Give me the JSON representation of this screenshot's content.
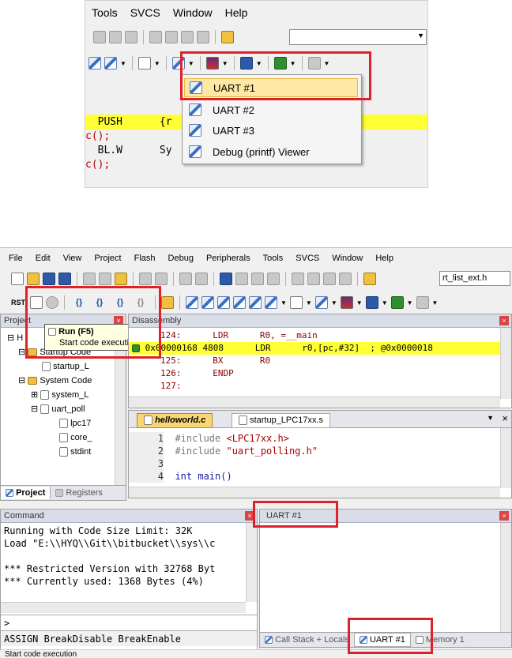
{
  "top": {
    "menu": [
      "Tools",
      "SVCS",
      "Window",
      "Help"
    ],
    "dropdown_items": [
      "UART #1",
      "UART #2",
      "UART #3",
      "Debug (printf) Viewer"
    ],
    "code": [
      {
        "text": "  PUSH      {r",
        "highlight": true
      },
      {
        "text": "c();",
        "highlight": false
      },
      {
        "text": "  BL.W      Sy",
        "highlight": false
      },
      {
        "text": "c();",
        "highlight": false
      }
    ]
  },
  "bottom": {
    "menu": [
      "File",
      "Edit",
      "View",
      "Project",
      "Flash",
      "Debug",
      "Peripherals",
      "Tools",
      "SVCS",
      "Window",
      "Help"
    ],
    "search_value": "rt_list_ext.h",
    "rst_label": "RST",
    "debug_buttons": [
      "{}",
      "{}",
      "{}",
      "{}"
    ],
    "project_panel": {
      "title": "Project",
      "tree": [
        {
          "label": "H",
          "depth": 0
        },
        {
          "label": "Startup Code",
          "depth": 1
        },
        {
          "label": "startup_L",
          "depth": 2
        },
        {
          "label": "System Code",
          "depth": 1
        },
        {
          "label": "system_L",
          "depth": 2
        },
        {
          "label": "uart_poll",
          "depth": 2
        },
        {
          "label": "lpc17",
          "depth": 3
        },
        {
          "label": "core_",
          "depth": 3
        },
        {
          "label": "stdint",
          "depth": 3
        }
      ],
      "tab_project": "Project",
      "tab_registers": "Registers"
    },
    "tooltip": {
      "title": "Run (F5)",
      "desc": "Start code execution"
    },
    "disassembly": {
      "title": "Disassembly",
      "lines": [
        {
          "addr": "124:",
          "code": "      LDR      R0, =__main",
          "highlight": false
        },
        {
          "addr": "0x00000168 4808",
          "code": "      LDR      r0,[pc,#32]  ; @0x0000018",
          "highlight": true
        },
        {
          "addr": "125:",
          "code": "      BX       R0",
          "highlight": false
        },
        {
          "addr": "126:",
          "code": "      ENDP",
          "highlight": false
        },
        {
          "addr": "127:",
          "code": "",
          "highlight": false
        }
      ]
    },
    "editor": {
      "tabs": [
        "helloworld.c",
        "startup_LPC17xx.s"
      ],
      "lines": [
        {
          "num": "1",
          "pre": "#include ",
          "str": "<LPC17xx.h>"
        },
        {
          "num": "2",
          "pre": "#include ",
          "str": "\"uart_polling.h\""
        },
        {
          "num": "3",
          "pre": "",
          "str": ""
        },
        {
          "num": "4",
          "pre": "int main()",
          "str": ""
        }
      ]
    },
    "command": {
      "title": "Command",
      "lines": [
        "Running with Code Size Limit: 32K",
        "Load \"E:\\\\HYQ\\\\Git\\\\bitbucket\\\\sys\\\\c",
        "",
        "*** Restricted Version with 32768 Byt",
        "*** Currently used: 1368 Bytes (4%)"
      ],
      "prompt": ">",
      "hint": "ASSIGN BreakDisable BreakEnable"
    },
    "uart_panel": {
      "title": "UART #1",
      "tabs": [
        "Call Stack + Locals",
        "UART #1",
        "Memory 1"
      ]
    },
    "status": "Start code execution"
  },
  "colors": {
    "highlight": "#ffff33",
    "red_box": "#e0202a",
    "panel_header": "#d9dde7"
  }
}
